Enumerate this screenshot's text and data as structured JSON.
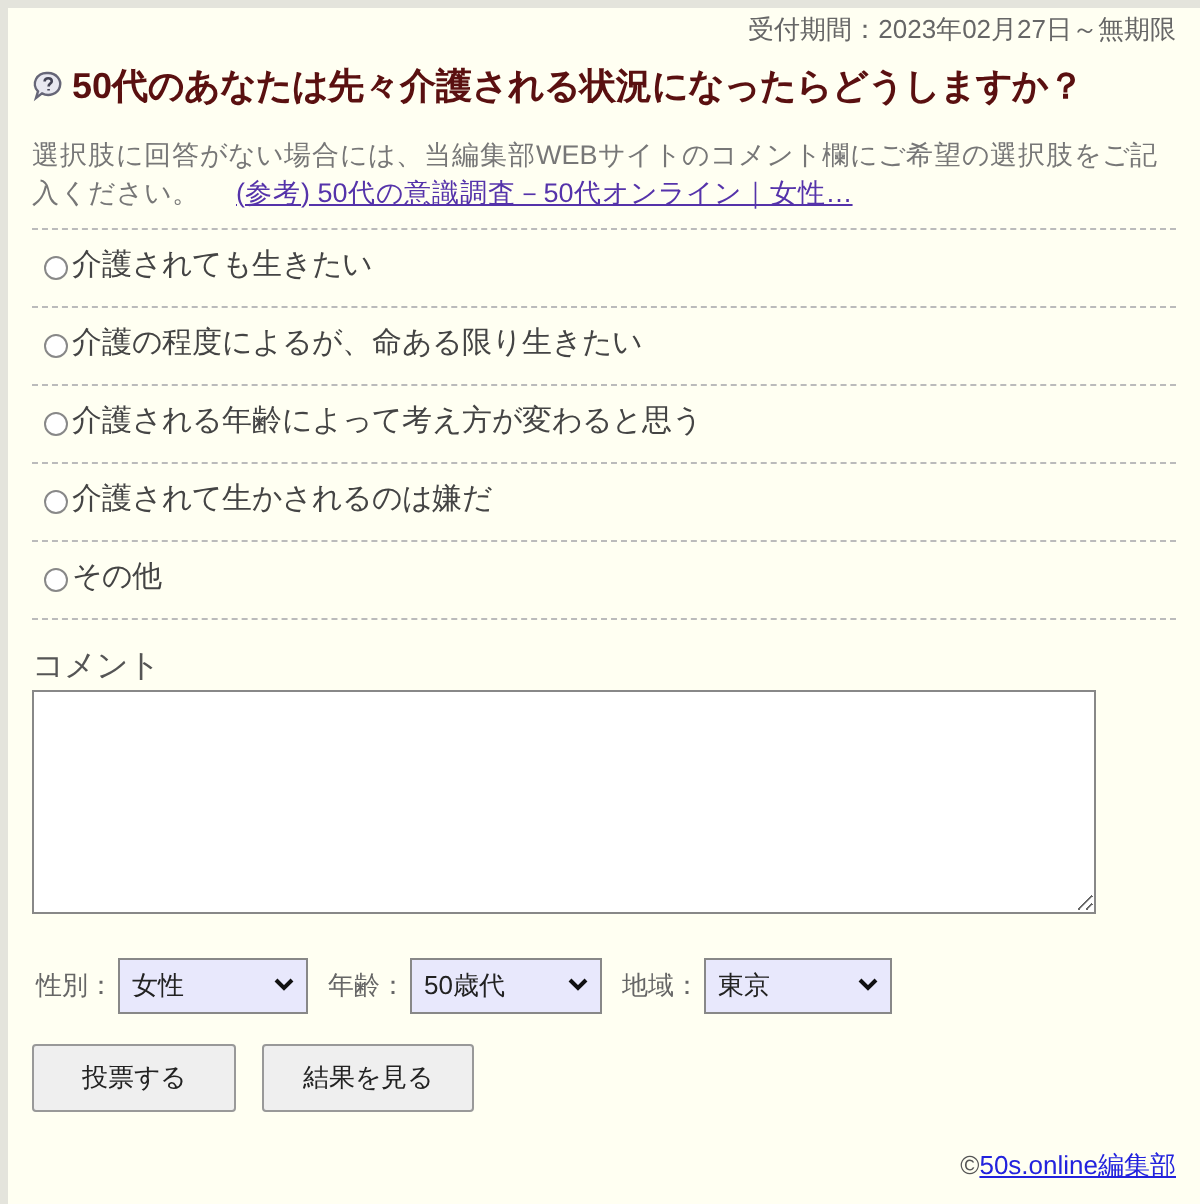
{
  "period": "受付期間：2023年02月27日～無期限",
  "title": "50代のあなたは先々介護される状況になったらどうしますか？",
  "description": "選択肢に回答がない場合には、当編集部WEBサイトのコメント欄にご希望の選択肢をご記入ください。",
  "reference_link": "(参考) 50代の意識調査－50代オンライン｜女性…",
  "options": [
    {
      "label": "介護されても生きたい",
      "selected": false
    },
    {
      "label": "介護の程度によるが、命ある限り生きたい",
      "selected": false
    },
    {
      "label": "介護される年齢によって考え方が変わると思う",
      "selected": false
    },
    {
      "label": "介護されて生かされるのは嫌だ",
      "selected": false
    },
    {
      "label": "その他",
      "selected": false
    }
  ],
  "comment": {
    "label": "コメント"
  },
  "selects": [
    {
      "label": "性別：",
      "value": "女性"
    },
    {
      "label": "年齢：",
      "value": "50歳代"
    },
    {
      "label": "地域：",
      "value": "東京"
    }
  ],
  "buttons": [
    "投票する",
    "結果を見る"
  ],
  "footer": {
    "mark": "©",
    "link": "50s.online編集部"
  }
}
